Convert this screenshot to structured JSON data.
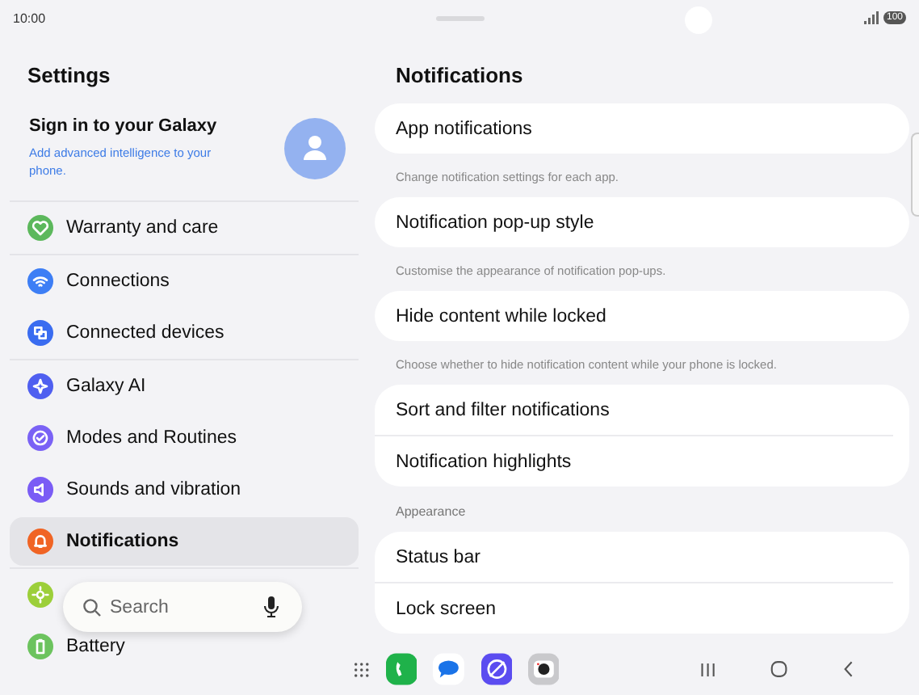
{
  "status_bar": {
    "time": "10:00",
    "battery": "100"
  },
  "sidebar": {
    "title": "Settings",
    "account": {
      "title": "Sign in to your Galaxy",
      "subtitle": "Add advanced intelligence to your phone."
    },
    "groups": [
      {
        "items": [
          {
            "label": "Warranty and care",
            "color": "#5cb85c",
            "selected": false
          }
        ]
      },
      {
        "items": [
          {
            "label": "Connections",
            "color": "#3d7ef5",
            "selected": false
          },
          {
            "label": "Connected devices",
            "color": "#3a6cf0",
            "selected": false
          }
        ]
      },
      {
        "items": [
          {
            "label": "Galaxy AI",
            "color": "#4f5ff0",
            "selected": false
          },
          {
            "label": "Modes and Routines",
            "color": "#7a62f5",
            "selected": false
          },
          {
            "label": "Sounds and vibration",
            "color": "#7a5cf5",
            "selected": false
          },
          {
            "label": "Notifications",
            "color": "#f06424",
            "selected": true
          }
        ]
      },
      {
        "items": [
          {
            "color": "#9ccf3a",
            "selected": false
          },
          {
            "label": "Battery",
            "color": "#6cc35e",
            "selected": false
          }
        ]
      }
    ]
  },
  "search": {
    "placeholder": "Search"
  },
  "content": {
    "title": "Notifications",
    "blocks": [
      {
        "kind": "card",
        "rows": [
          "App notifications"
        ]
      },
      {
        "kind": "caption",
        "text": "Change notification settings for each app."
      },
      {
        "kind": "card",
        "rows": [
          "Notification pop-up style"
        ]
      },
      {
        "kind": "caption",
        "text": "Customise the appearance of notification pop-ups."
      },
      {
        "kind": "card",
        "rows": [
          "Hide content while locked"
        ]
      },
      {
        "kind": "caption",
        "text": "Choose whether to hide notification content while your phone is locked."
      },
      {
        "kind": "card",
        "rows": [
          "Sort and filter notifications",
          "Notification highlights"
        ]
      },
      {
        "kind": "heading",
        "text": "Appearance"
      },
      {
        "kind": "card",
        "rows": [
          "Status bar",
          "Lock screen"
        ]
      }
    ]
  }
}
